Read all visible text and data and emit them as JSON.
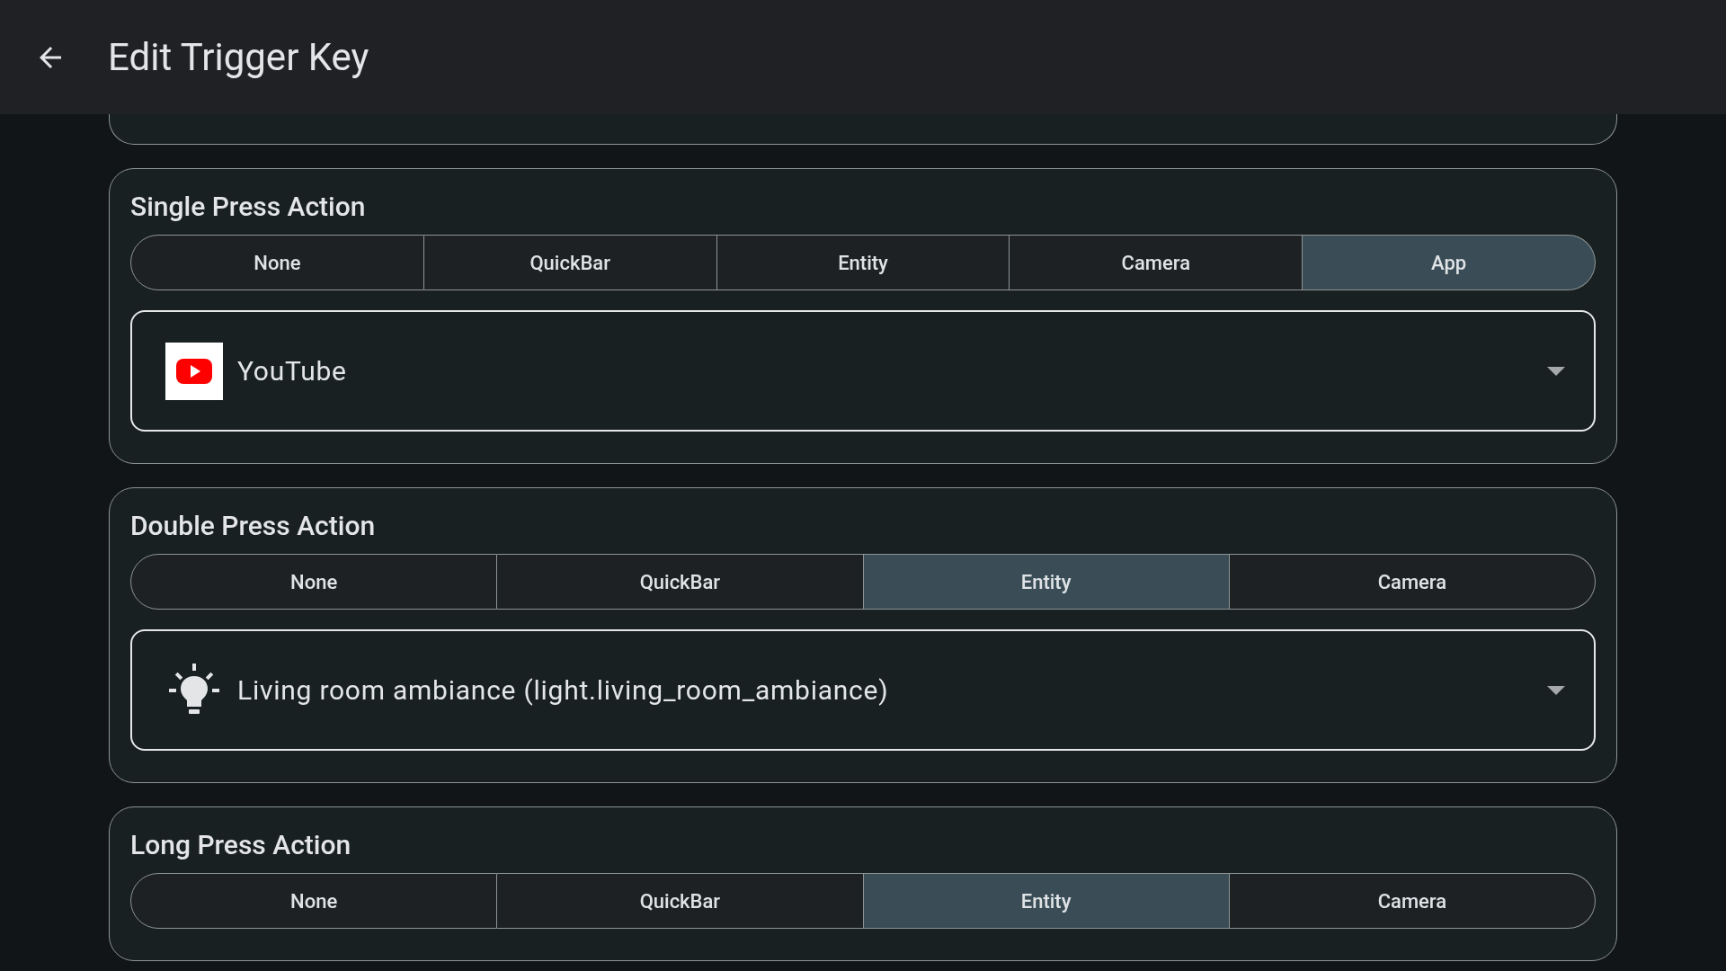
{
  "header": {
    "title": "Edit Trigger Key"
  },
  "sections": [
    {
      "title": "Single Press Action",
      "options": [
        {
          "label": "None",
          "selected": false
        },
        {
          "label": "QuickBar",
          "selected": false
        },
        {
          "label": "Entity",
          "selected": false
        },
        {
          "label": "Camera",
          "selected": false
        },
        {
          "label": "App",
          "selected": true
        }
      ],
      "dropdown": {
        "kind": "app",
        "value": "YouTube"
      }
    },
    {
      "title": "Double Press Action",
      "options": [
        {
          "label": "None",
          "selected": false
        },
        {
          "label": "QuickBar",
          "selected": false
        },
        {
          "label": "Entity",
          "selected": true
        },
        {
          "label": "Camera",
          "selected": false
        }
      ],
      "dropdown": {
        "kind": "entity",
        "value": "Living room ambiance (light.living_room_ambiance)"
      }
    },
    {
      "title": "Long Press Action",
      "options": [
        {
          "label": "None",
          "selected": false
        },
        {
          "label": "QuickBar",
          "selected": false
        },
        {
          "label": "Entity",
          "selected": true
        },
        {
          "label": "Camera",
          "selected": false
        }
      ]
    }
  ]
}
